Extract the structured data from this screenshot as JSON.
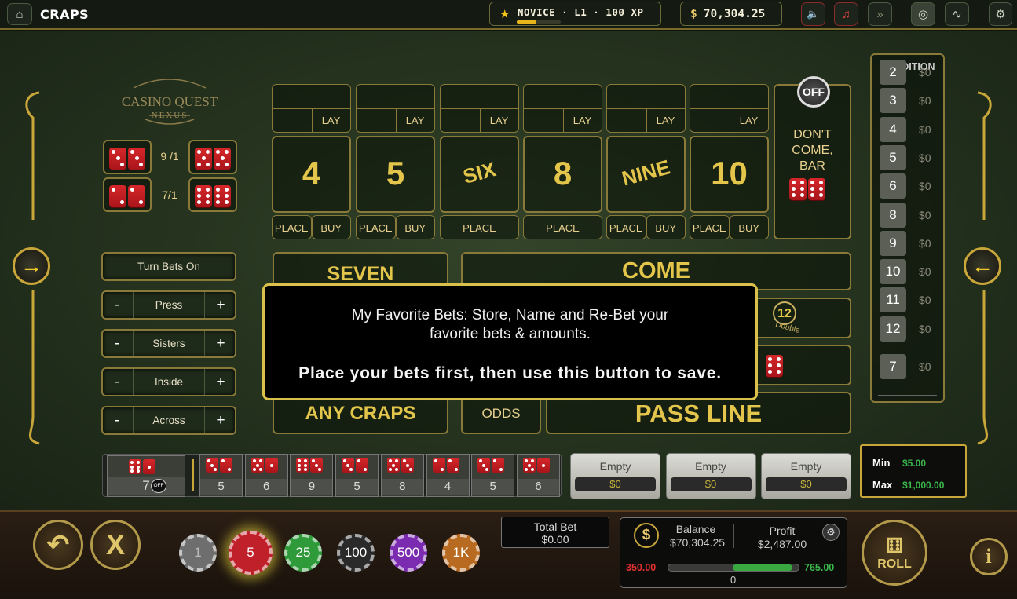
{
  "header": {
    "title": "CRAPS",
    "level_text": "NOVICE · L1 · 100 XP",
    "xp_progress": 0.45,
    "balance_currency": "$",
    "balance": "70,304.25"
  },
  "logo": {
    "line1": "CASINO QUEST",
    "line2": "NEXUS"
  },
  "hop_bets": [
    {
      "odds": "9 /1"
    },
    {
      "odds": "7/1"
    }
  ],
  "side_buttons": {
    "turn_bets": "Turn Bets On",
    "press": "Press",
    "sisters": "Sisters",
    "inside": "Inside",
    "across": "Across",
    "minus": "-",
    "plus": "+"
  },
  "numbers": [
    {
      "label": "4",
      "lay": "LAY",
      "a": "PLACE",
      "b": "BUY"
    },
    {
      "label": "5",
      "lay": "LAY",
      "a": "PLACE",
      "b": "BUY"
    },
    {
      "label": "SIX",
      "lay": "LAY",
      "a": "PLACE",
      "b": ""
    },
    {
      "label": "8",
      "lay": "LAY",
      "a": "PLACE",
      "b": ""
    },
    {
      "label": "NINE",
      "lay": "LAY",
      "a": "PLACE",
      "b": "BUY"
    },
    {
      "label": "10",
      "lay": "LAY",
      "a": "PLACE",
      "b": "BUY"
    }
  ],
  "dont_come": {
    "toggle": "OFF",
    "line1": "DON'T",
    "line2": "COME,",
    "line3": "BAR"
  },
  "bets": {
    "seven": "SEVEN",
    "come": "COME",
    "any_craps": "ANY CRAPS",
    "odds": "ODDS",
    "pass_line": "PASS LINE",
    "twelve": "12",
    "double": "Double"
  },
  "condition": {
    "title": "CONDITION",
    "rows": [
      {
        "n": "2",
        "v": "$0"
      },
      {
        "n": "3",
        "v": "$0"
      },
      {
        "n": "4",
        "v": "$0"
      },
      {
        "n": "5",
        "v": "$0"
      },
      {
        "n": "6",
        "v": "$0"
      },
      {
        "n": "8",
        "v": "$0"
      },
      {
        "n": "9",
        "v": "$0"
      },
      {
        "n": "10",
        "v": "$0"
      },
      {
        "n": "11",
        "v": "$0"
      },
      {
        "n": "12",
        "v": "$0"
      },
      {
        "n": "7",
        "v": "$0"
      }
    ]
  },
  "history": {
    "current": "7",
    "current_tag": "OFF",
    "rolls": [
      "5",
      "6",
      "9",
      "5",
      "8",
      "4",
      "5",
      "6"
    ]
  },
  "favorites": [
    {
      "name": "Empty",
      "amt": "$0"
    },
    {
      "name": "Empty",
      "amt": "$0"
    },
    {
      "name": "Empty",
      "amt": "$0"
    }
  ],
  "limits": {
    "min_label": "Min",
    "min": "$5.00",
    "max_label": "Max",
    "max": "$1,000.00"
  },
  "modal": {
    "line1": "My Favorite Bets: Store, Name and Re-Bet your",
    "line2": "favorite bets & amounts.",
    "line3": "Place your bets first, then use this button to save."
  },
  "chips": [
    {
      "v": "1",
      "color": "#6e6e6e"
    },
    {
      "v": "5",
      "color": "#c0202a"
    },
    {
      "v": "25",
      "color": "#2f9a3a"
    },
    {
      "v": "100",
      "color": "#2a2a2a"
    },
    {
      "v": "500",
      "color": "#7a2bb0"
    },
    {
      "v": "1K",
      "color": "#b86a20"
    }
  ],
  "total_bet": {
    "label": "Total Bet",
    "value": "$0.00"
  },
  "stats": {
    "balance_label": "Balance",
    "balance": "$70,304.25",
    "profit_label": "Profit",
    "profit": "$2,487.00",
    "low": "350.00",
    "zero": "0",
    "high": "765.00"
  },
  "roll": "ROLL"
}
